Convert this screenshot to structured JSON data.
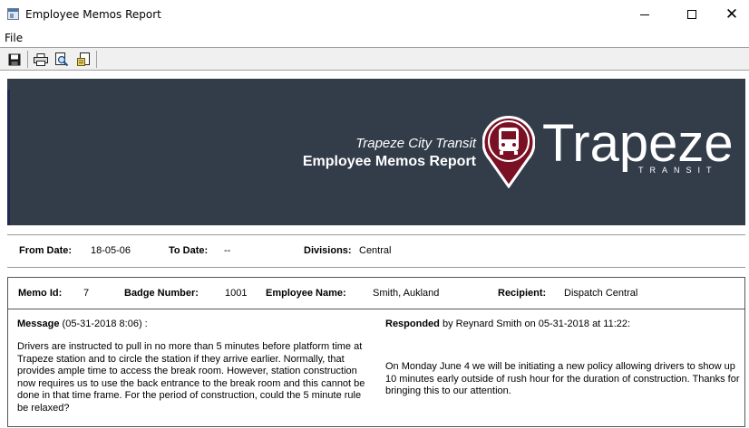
{
  "window": {
    "title": "Employee Memos Report"
  },
  "menu": {
    "file_label": "File"
  },
  "toolbar": {
    "icons": [
      "save-icon",
      "print-icon",
      "print-preview-icon",
      "page-setup-icon"
    ]
  },
  "banner": {
    "subtitle": "Trapeze City Transit",
    "title": "Employee Memos Report",
    "logo_word": "Trapeze",
    "logo_sub": "TRANSIT",
    "colors": {
      "background": "#333c49",
      "pin": "#7a1024"
    }
  },
  "filters": {
    "from_date_label": "From Date:",
    "from_date_value": "18-05-06",
    "to_date_label": "To Date:",
    "to_date_value": "--",
    "divisions_label": "Divisions:",
    "divisions_value": "Central"
  },
  "memo": {
    "memo_id_label": "Memo Id:",
    "memo_id_value": "7",
    "badge_label": "Badge Number:",
    "badge_value": "1001",
    "employee_label": "Employee Name:",
    "employee_value": "Smith, Aukland",
    "recipient_label": "Recipient:",
    "recipient_value": "Dispatch Central",
    "message_label": "Message",
    "message_meta": "(05-31-2018  8:06) :",
    "message_body": "Drivers are instructed to pull in no more than 5 minutes before platform time at Trapeze station and to circle the station if they arrive earlier. Normally, that provides ample time to access the break room. However, station construction now requires us to use the back entrance to the break room and this cannot be done in that time frame. For the period of construction, could the 5 minute rule be relaxed?",
    "responded_label": "Responded",
    "responded_meta": "by Reynard Smith on 05-31-2018 at 11:22:",
    "response_body": "On Monday June 4 we will be initiating a new policy allowing drivers to show up 10 minutes early outside of rush hour for the duration of construction. Thanks for bringing this to our attention."
  }
}
